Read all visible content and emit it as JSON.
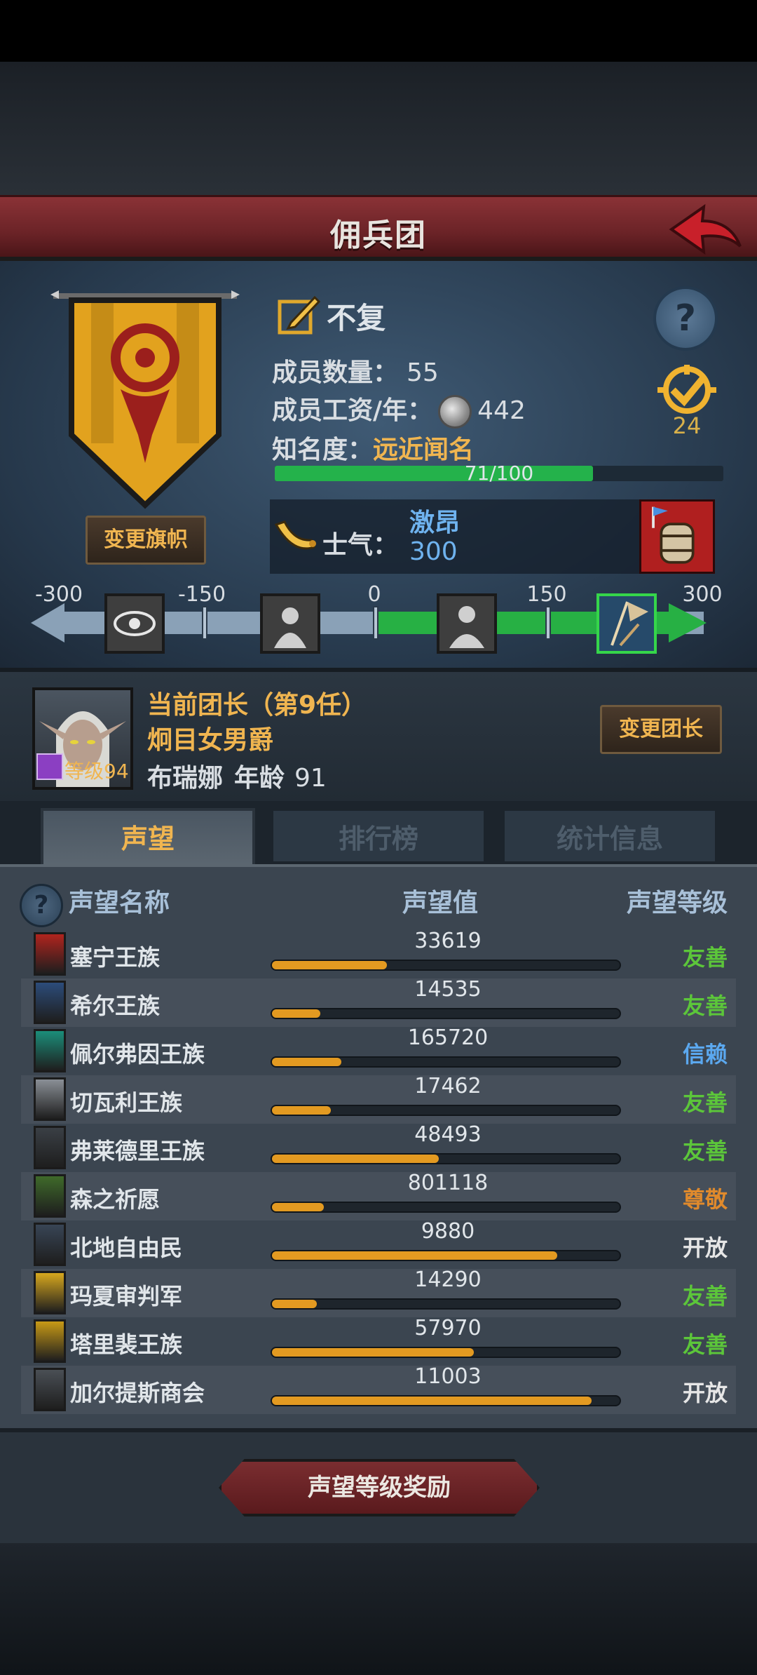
{
  "header": {
    "title": "佣兵团"
  },
  "guild": {
    "name": "不复",
    "members_label": "成员数量：",
    "members_value": "55",
    "salary_label": "成员工资/年：",
    "salary_value": "442",
    "fame_label": "知名度：",
    "fame_value": "远近闻名",
    "fame_progress_text": "71/100",
    "fame_progress": 0.71,
    "medal_count": "24",
    "change_flag_label": "变更旗帜",
    "morale_label": "士气：",
    "morale_state": "激昂",
    "morale_value": "300"
  },
  "morale_scale": {
    "labels": [
      "-300",
      "-150",
      "0",
      "150",
      "300"
    ]
  },
  "leader": {
    "title": "当前团长（第9任）",
    "rank": "炯目女男爵",
    "name": "布瑞娜",
    "age_label": "年龄",
    "age_value": "91",
    "level_label": "等级94",
    "change_leader_label": "变更团长"
  },
  "tabs": [
    {
      "label": "声望",
      "active": true
    },
    {
      "label": "排行榜",
      "active": false
    },
    {
      "label": "统计信息",
      "active": false
    }
  ],
  "table": {
    "col_name": "声望名称",
    "col_value": "声望值",
    "col_level": "声望等级",
    "rows": [
      {
        "name": "塞宁王族",
        "value": "33619",
        "level": "友善",
        "progress": 0.33,
        "level_color": "#5cc63a",
        "icon_color": "#b0241e"
      },
      {
        "name": "希尔王族",
        "value": "14535",
        "level": "友善",
        "progress": 0.14,
        "level_color": "#5cc63a",
        "icon_color": "#2c4c7a"
      },
      {
        "name": "佩尔弗因王族",
        "value": "165720",
        "level": "信赖",
        "progress": 0.2,
        "level_color": "#5ba8ef",
        "icon_color": "#1b8e7a"
      },
      {
        "name": "切瓦利王族",
        "value": "17462",
        "level": "友善",
        "progress": 0.17,
        "level_color": "#5cc63a",
        "icon_color": "#8a8f96"
      },
      {
        "name": "弗莱德里王族",
        "value": "48493",
        "level": "友善",
        "progress": 0.48,
        "level_color": "#5cc63a",
        "icon_color": "#3a3f45"
      },
      {
        "name": "森之祈愿",
        "value": "801118",
        "level": "尊敬",
        "progress": 0.15,
        "level_color": "#e08a2c",
        "icon_color": "#3f6a2a"
      },
      {
        "name": "北地自由民",
        "value": "9880",
        "level": "开放",
        "progress": 0.82,
        "level_color": "#e6e6e6",
        "icon_color": "#384555"
      },
      {
        "name": "玛夏审判军",
        "value": "14290",
        "level": "友善",
        "progress": 0.13,
        "level_color": "#5cc63a",
        "icon_color": "#d8a81e"
      },
      {
        "name": "塔里裴王族",
        "value": "57970",
        "level": "友善",
        "progress": 0.58,
        "level_color": "#5cc63a",
        "icon_color": "#c89a16"
      },
      {
        "name": "加尔提斯商会",
        "value": "11003",
        "level": "开放",
        "progress": 0.92,
        "level_color": "#e6e6e6",
        "icon_color": "#4a4f55"
      }
    ]
  },
  "reward_button": {
    "label": "声望等级奖励"
  }
}
